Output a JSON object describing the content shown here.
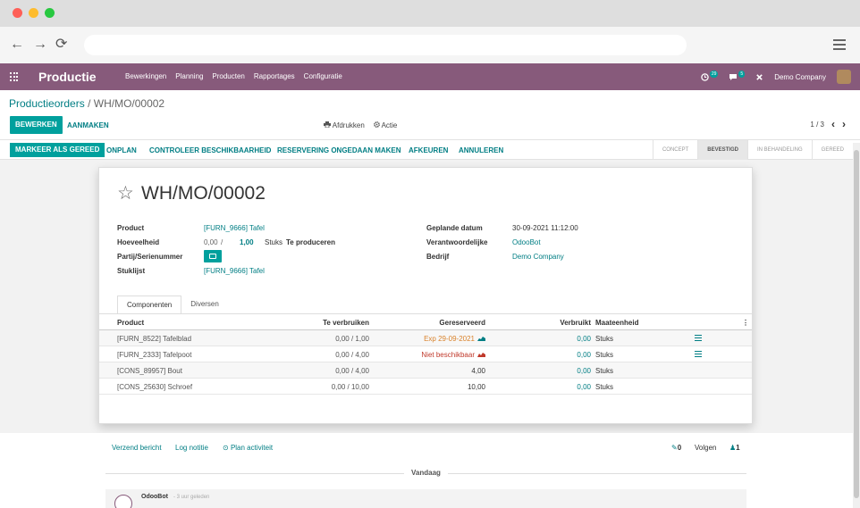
{
  "browser": {
    "nav": {
      "back": "←",
      "forward": "→",
      "reload": "⟳"
    }
  },
  "navbar": {
    "app_name": "Productie",
    "menu": [
      "Bewerkingen",
      "Planning",
      "Producten",
      "Rapportages",
      "Configuratie"
    ],
    "activity_count": "29",
    "message_count": "5",
    "company": "Demo Company"
  },
  "control": {
    "breadcrumb_parent": "Productieorders",
    "breadcrumb_sep": "/",
    "breadcrumb_current": "WH/MO/00002",
    "edit_label": "BEWERKEN",
    "create_label": "AANMAKEN",
    "print_label": "Afdrukken",
    "action_label": "Actie",
    "pager": "1 / 3"
  },
  "statusbar": {
    "buttons": [
      "MARKEER ALS GEREED",
      "ONPLAN",
      "CONTROLEER BESCHIKBAARHEID",
      "RESERVERING ONGEDAAN MAKEN",
      "AFKEUREN",
      "ANNULEREN"
    ],
    "stages": [
      "CONCEPT",
      "BEVESTIGD",
      "IN BEHANDELING",
      "GEREED"
    ],
    "active_stage": "BEVESTIGD"
  },
  "form": {
    "title": "WH/MO/00002",
    "product_label": "Product",
    "product_value": "[FURN_9666] Tafel",
    "quantity_label": "Hoeveelheid",
    "qty_produced": "0,00",
    "qty_sep": "/",
    "qty_total": "1,00",
    "qty_unit": "Stuks",
    "qty_to_produce": "Te produceren",
    "lot_label": "Partij/Serienummer",
    "bom_label": "Stuklijst",
    "bom_value": "[FURN_9666] Tafel",
    "planned_date_label": "Geplande datum",
    "planned_date_value": "30-09-2021 11:12:00",
    "responsible_label": "Verantwoordelijke",
    "responsible_value": "OdooBot",
    "company_label": "Bedrijf",
    "company_value": "Demo Company"
  },
  "tabs": [
    "Componenten",
    "Diversen"
  ],
  "components": {
    "headers": [
      "Product",
      "Te verbruiken",
      "Gereserveerd",
      "Verbruikt",
      "Maateenheid"
    ],
    "rows": [
      {
        "product": "[FURN_8522] Tafelblad",
        "to_consume": "0,00 / 1,00",
        "reserved": "Exp 29-09-2021",
        "reserved_state": "warn",
        "consumed": "0,00",
        "uom": "Stuks",
        "detail": true
      },
      {
        "product": "[FURN_2333] Tafelpoot",
        "to_consume": "0,00 / 4,00",
        "reserved": "Niet beschikbaar",
        "reserved_state": "bad",
        "consumed": "0,00",
        "uom": "Stuks",
        "detail": true
      },
      {
        "product": "[CONS_89957] Bout",
        "to_consume": "0,00 / 4,00",
        "reserved": "4,00",
        "reserved_state": "ok",
        "consumed": "0,00",
        "uom": "Stuks",
        "detail": false
      },
      {
        "product": "[CONS_25630] Schroef",
        "to_consume": "0,00 / 10,00",
        "reserved": "10,00",
        "reserved_state": "ok",
        "consumed": "0,00",
        "uom": "Stuks",
        "detail": false
      }
    ]
  },
  "chatter": {
    "send_message": "Verzend bericht",
    "log_note": "Log notitie",
    "schedule_activity": "Plan activiteit",
    "attachments": "0",
    "follow": "Volgen",
    "followers": "1",
    "separator": "Vandaag",
    "message_author": "OdooBot",
    "message_date": "- 3 uur geleden"
  },
  "colors": {
    "navbar": "#875a7b",
    "primary": "#00a09d",
    "link": "#017e84",
    "warning": "#d9822b",
    "danger": "#c0392b"
  }
}
